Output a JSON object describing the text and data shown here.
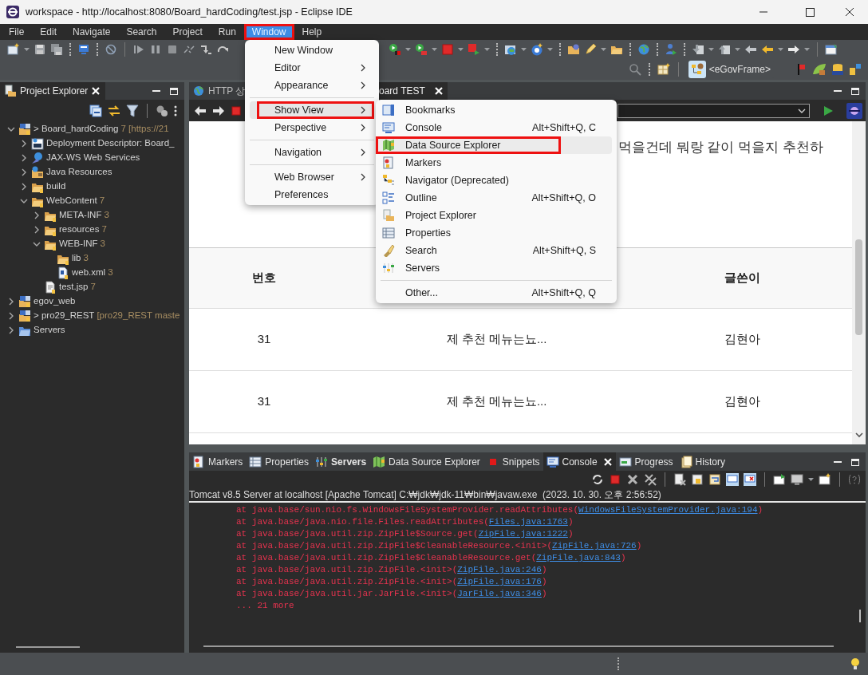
{
  "window": {
    "title": "workspace - http://localhost:8080/Board_hardCoding/test.jsp - Eclipse IDE"
  },
  "menu_bar": [
    {
      "label": "File",
      "selected": false,
      "annotated": false
    },
    {
      "label": "Edit",
      "selected": false,
      "annotated": false
    },
    {
      "label": "Navigate",
      "selected": false,
      "annotated": false
    },
    {
      "label": "Search",
      "selected": false,
      "annotated": false
    },
    {
      "label": "Project",
      "selected": false,
      "annotated": false
    },
    {
      "label": "Run",
      "selected": false,
      "annotated": false
    },
    {
      "label": "Window",
      "selected": true,
      "annotated": true
    },
    {
      "label": "Help",
      "selected": false,
      "annotated": false
    }
  ],
  "window_menu": {
    "groups": [
      [
        {
          "label": "New Window",
          "submenu": false,
          "selected": false,
          "annotated": false
        },
        {
          "label": "Editor",
          "submenu": true,
          "selected": false,
          "annotated": false
        },
        {
          "label": "Appearance",
          "submenu": true,
          "selected": false,
          "annotated": false
        }
      ],
      [
        {
          "label": "Show View",
          "submenu": true,
          "selected": true,
          "annotated": true
        },
        {
          "label": "Perspective",
          "submenu": true,
          "selected": false,
          "annotated": false
        }
      ],
      [
        {
          "label": "Navigation",
          "submenu": true,
          "selected": false,
          "annotated": false
        }
      ],
      [
        {
          "label": "Web Browser",
          "submenu": true,
          "selected": false,
          "annotated": false
        },
        {
          "label": "Preferences",
          "submenu": false,
          "selected": false,
          "annotated": false
        }
      ]
    ]
  },
  "show_view_menu": {
    "groups": [
      [
        {
          "label": "Bookmarks",
          "kind": "bookmarks",
          "selected": false,
          "annotated": false
        },
        {
          "label": "Console",
          "kind": "console",
          "shortcut": "Alt+Shift+Q, C",
          "selected": false,
          "annotated": false
        },
        {
          "label": "Data Source Explorer",
          "kind": "data-source",
          "selected": true,
          "annotated": true
        },
        {
          "label": "Markers",
          "kind": "markers",
          "selected": false,
          "annotated": false
        },
        {
          "label": "Navigator (Deprecated)",
          "kind": "navigator",
          "selected": false,
          "annotated": false
        },
        {
          "label": "Outline",
          "kind": "outline",
          "shortcut": "Alt+Shift+Q, O",
          "selected": false,
          "annotated": false
        },
        {
          "label": "Project Explorer",
          "kind": "project-explorer",
          "selected": false,
          "annotated": false
        },
        {
          "label": "Properties",
          "kind": "properties",
          "selected": false,
          "annotated": false
        },
        {
          "label": "Search",
          "kind": "search",
          "shortcut": "Alt+Shift+Q, S",
          "selected": false,
          "annotated": false
        },
        {
          "label": "Servers",
          "kind": "servers",
          "selected": false,
          "annotated": false
        }
      ],
      [
        {
          "label": "Other...",
          "kind": "other",
          "shortcut": "Alt+Shift+Q, Q",
          "selected": false,
          "annotated": false
        }
      ]
    ]
  },
  "toolbar": {
    "perspective": {
      "label": "<eGovFrame>",
      "selected": true
    }
  },
  "project_explorer": {
    "title": "Project Explorer",
    "tree": [
      {
        "label": "> Board_hardCoding",
        "decoration": "7 [https://21",
        "kind": "project",
        "expanded": true,
        "children": [
          {
            "label": "Deployment Descriptor: Board_",
            "kind": "descriptor",
            "expanded": false
          },
          {
            "label": "JAX-WS Web Services",
            "kind": "services",
            "expanded": false
          },
          {
            "label": "Java Resources",
            "kind": "java-resources",
            "expanded": false
          },
          {
            "label": "build",
            "kind": "folder",
            "expanded": false
          },
          {
            "label": "WebContent",
            "decoration": "7",
            "kind": "folder",
            "expanded": true,
            "children": [
              {
                "label": "META-INF",
                "decoration": "3",
                "kind": "folder",
                "expanded": false
              },
              {
                "label": "resources",
                "decoration": "7",
                "kind": "folder",
                "expanded": false
              },
              {
                "label": "WEB-INF",
                "decoration": "3",
                "kind": "folder",
                "expanded": true,
                "children": [
                  {
                    "label": "lib",
                    "decoration": "3",
                    "kind": "folder"
                  },
                  {
                    "label": "web.xml",
                    "decoration": "3",
                    "kind": "xml"
                  }
                ]
              },
              {
                "label": "test.jsp",
                "decoration": "7",
                "kind": "jsp"
              }
            ]
          }
        ]
      },
      {
        "label": "egov_web",
        "kind": "project",
        "expanded": false
      },
      {
        "label": "> pro29_REST",
        "decoration": "[pro29_REST maste",
        "kind": "project",
        "expanded": false
      },
      {
        "label": "Servers",
        "kind": "servers-folder",
        "expanded": false
      }
    ]
  },
  "editor": {
    "tabs": [
      {
        "label": "HTTP 상",
        "selected": false
      },
      {
        "label": "oard TEST",
        "selected": true
      }
    ],
    "page": {
      "text": "먹을건데 뭐랑 같이 먹을지 추천하",
      "table": {
        "columns": [
          "번호",
          "글쓴이"
        ],
        "rows": [
          {
            "number": "31",
            "title": "제 추천 메뉴는뇨...",
            "author": "김현아"
          },
          {
            "number": "31",
            "title": "제 추천 메뉴는뇨...",
            "author": "김현아"
          }
        ]
      }
    }
  },
  "bottom_panel": {
    "tabs": [
      {
        "label": "Markers",
        "kind": "markers",
        "selected": false,
        "bold": false
      },
      {
        "label": "Properties",
        "kind": "properties",
        "selected": false,
        "bold": false
      },
      {
        "label": "Servers",
        "kind": "servers",
        "selected": false,
        "bold": true
      },
      {
        "label": "Data Source Explorer",
        "kind": "data-source",
        "selected": false,
        "bold": false
      },
      {
        "label": "Snippets",
        "kind": "snippets",
        "selected": false,
        "bold": false
      },
      {
        "label": "Console",
        "kind": "console",
        "selected": true,
        "bold": false
      },
      {
        "label": "Progress",
        "kind": "progress",
        "selected": false,
        "bold": false
      },
      {
        "label": "History",
        "kind": "history",
        "selected": false,
        "bold": false
      }
    ],
    "console": {
      "header": "Tomcat v8.5 Server at localhost [Apache Tomcat] C:₩jdk₩jdk-11₩bin₩javaw.exe  (2023. 10. 30. 오후 2:56:52)",
      "lines": [
        {
          "text": "at java.base/sun.nio.fs.WindowsFileSystemProvider.readAttributes(",
          "link": "WindowsFileSystemProvider.java:194",
          "suffix": ")"
        },
        {
          "text": "at java.base/java.nio.file.Files.readAttributes(",
          "link": "Files.java:1763",
          "suffix": ")"
        },
        {
          "text": "at java.base/java.util.zip.ZipFile$Source.get(",
          "link": "ZipFile.java:1222",
          "suffix": ")"
        },
        {
          "text": "at java.base/java.util.zip.ZipFile$CleanableResource.<init>(",
          "link": "ZipFile.java:726",
          "suffix": ")"
        },
        {
          "text": "at java.base/java.util.zip.ZipFile$CleanableResource.get(",
          "link": "ZipFile.java:843",
          "suffix": ")"
        },
        {
          "text": "at java.base/java.util.zip.ZipFile.<init>(",
          "link": "ZipFile.java:246",
          "suffix": ")"
        },
        {
          "text": "at java.base/java.util.zip.ZipFile.<init>(",
          "link": "ZipFile.java:176",
          "suffix": ")"
        },
        {
          "text": "at java.base/java.util.jar.JarFile.<init>(",
          "link": "JarFile.java:346",
          "suffix": ")"
        },
        {
          "text": "... 21 more"
        }
      ]
    }
  }
}
